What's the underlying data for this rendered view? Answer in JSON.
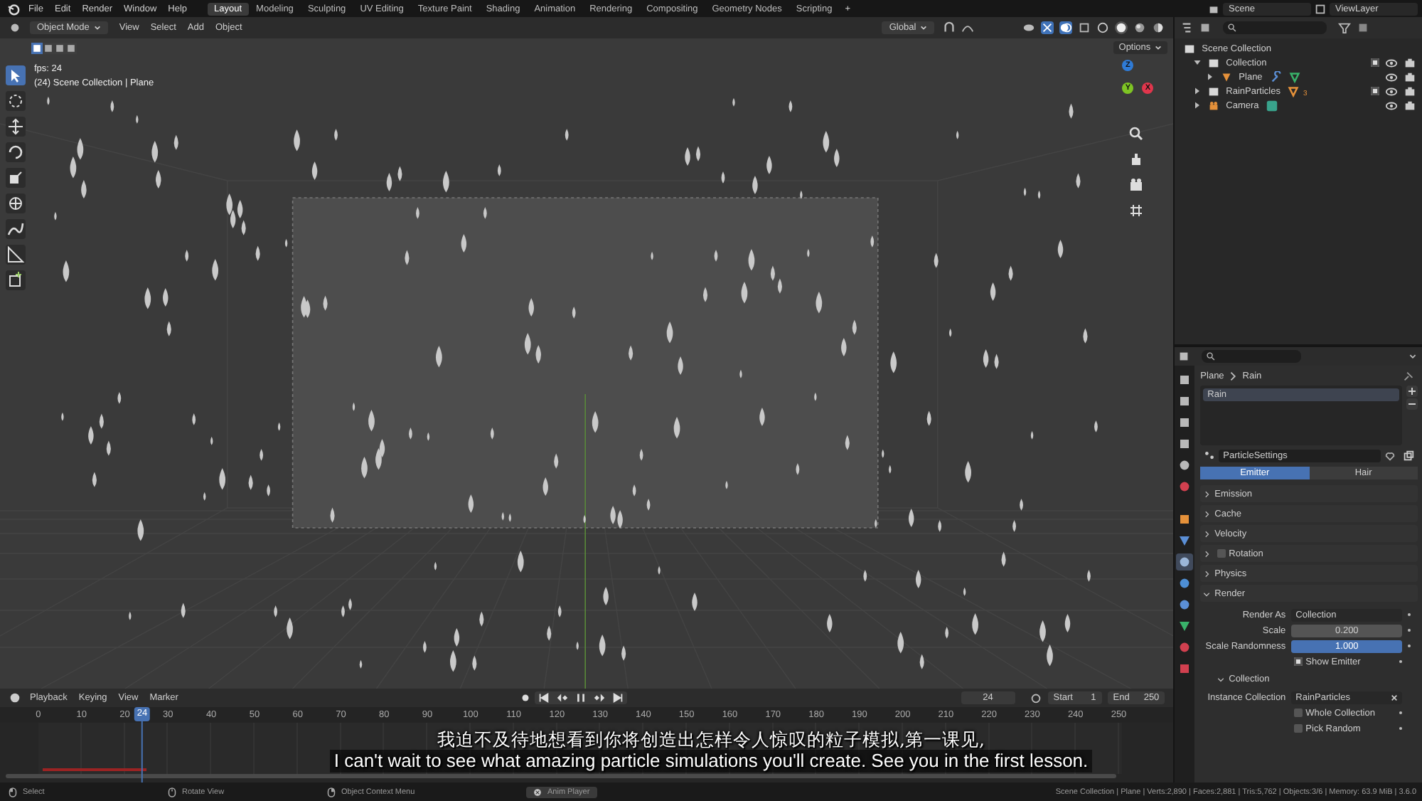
{
  "top_bar": {
    "menus": [
      "File",
      "Edit",
      "Render",
      "Window",
      "Help"
    ],
    "workspaces": [
      {
        "label": "Layout",
        "selected": true
      },
      {
        "label": "Modeling",
        "selected": false
      },
      {
        "label": "Sculpting",
        "selected": false
      },
      {
        "label": "UV Editing",
        "selected": false
      },
      {
        "label": "Texture Paint",
        "selected": false
      },
      {
        "label": "Shading",
        "selected": false
      },
      {
        "label": "Animation",
        "selected": false
      },
      {
        "label": "Rendering",
        "selected": false
      },
      {
        "label": "Compositing",
        "selected": false
      },
      {
        "label": "Geometry Nodes",
        "selected": false
      },
      {
        "label": "Scripting",
        "selected": false
      }
    ],
    "add_workspace": "+",
    "scene": "Scene",
    "view_layer": "ViewLayer"
  },
  "viewport": {
    "mode": "Object Mode",
    "menus": [
      "View",
      "Select",
      "Add",
      "Object"
    ],
    "orientation": "Global",
    "shading": [
      {
        "kind": "wireframe",
        "selected": false
      },
      {
        "kind": "solid",
        "selected": true
      },
      {
        "kind": "material",
        "selected": false
      },
      {
        "kind": "rendered",
        "selected": false
      }
    ],
    "overlay_text": [
      "fps: 24",
      "(24) Scene Collection | Plane"
    ],
    "options": "Options",
    "tools": [
      {
        "kind": "select",
        "selected": true
      },
      {
        "kind": "cursor",
        "selected": false
      },
      {
        "kind": "move",
        "selected": false
      },
      {
        "kind": "rotate",
        "selected": false
      },
      {
        "kind": "scale",
        "selected": false
      },
      {
        "kind": "transform",
        "selected": false
      },
      {
        "kind": "annotate",
        "selected": false
      },
      {
        "kind": "measure",
        "selected": false
      },
      {
        "kind": "add_cube",
        "selected": false
      }
    ],
    "gizmo_axes": [
      {
        "label": "Z",
        "color": "#2f7bd6"
      },
      {
        "label": "Y",
        "color": "#7ec424"
      },
      {
        "label": "X",
        "color": "#e0364c"
      }
    ]
  },
  "outliner": {
    "tree": [
      {
        "label": "Scene Collection",
        "kind": "scene",
        "children": [
          {
            "label": "Collection",
            "kind": "collection",
            "expanded": true,
            "checked": true,
            "children": [
              {
                "label": "Plane",
                "kind": "mesh",
                "expanded": false,
                "modifier": true,
                "mesh_data": true
              }
            ]
          },
          {
            "label": "RainParticles",
            "kind": "collection",
            "expanded": false,
            "checked": true,
            "mesh_data": true,
            "count": "3"
          },
          {
            "label": "Camera",
            "kind": "camera",
            "expanded": false,
            "camera_data": true
          }
        ]
      }
    ]
  },
  "properties": {
    "tabs": [
      {
        "kind": "tool",
        "selected": false
      },
      {
        "kind": "render",
        "selected": false
      },
      {
        "kind": "output",
        "selected": false
      },
      {
        "kind": "view_layer",
        "selected": false
      },
      {
        "kind": "scene",
        "selected": false
      },
      {
        "kind": "world",
        "selected": false
      },
      {
        "kind": "object",
        "selected": false
      },
      {
        "kind": "modifiers",
        "selected": false
      },
      {
        "kind": "particles",
        "selected": true
      },
      {
        "kind": "physics",
        "selected": false
      },
      {
        "kind": "constraints",
        "selected": false
      },
      {
        "kind": "data",
        "selected": false
      },
      {
        "kind": "material",
        "selected": false
      },
      {
        "kind": "texture",
        "selected": false
      }
    ],
    "breadcrumb": [
      "Plane",
      "Rain"
    ],
    "particle_systems": [
      {
        "label": "Rain",
        "selected": true
      }
    ],
    "settings_name": "ParticleSettings",
    "type_tabs": [
      {
        "label": "Emitter",
        "selected": true
      },
      {
        "label": "Hair",
        "selected": false
      }
    ],
    "panels": [
      {
        "label": "Emission",
        "expanded": false
      },
      {
        "label": "Cache",
        "expanded": false
      },
      {
        "label": "Velocity",
        "expanded": false
      },
      {
        "label": "Rotation",
        "expanded": false,
        "checked": false
      },
      {
        "label": "Physics",
        "expanded": false
      },
      {
        "label": "Render",
        "expanded": true
      }
    ],
    "render_rows": [
      {
        "kind": "dropdown",
        "label": "Render As",
        "value": "Collection"
      },
      {
        "kind": "number",
        "label": "Scale",
        "value": "0.200"
      },
      {
        "kind": "slider",
        "label": "Scale Randomness",
        "value": "1.000",
        "level": 1
      },
      {
        "kind": "checkbox",
        "label": "Show Emitter",
        "checked": true
      }
    ],
    "subpanel": {
      "label": "Collection",
      "expanded": true,
      "rows": [
        {
          "kind": "field",
          "label": "Instance Collection",
          "value": "RainParticles"
        },
        {
          "kind": "checkbox",
          "label": "Whole Collection",
          "checked": false
        },
        {
          "kind": "checkbox",
          "label": "Pick Random",
          "checked": false
        }
      ]
    }
  },
  "timeline": {
    "menus": [
      "Playback",
      "Keying",
      "View",
      "Marker"
    ],
    "ticks": [
      "0",
      "10",
      "20",
      "30",
      "40",
      "50",
      "60",
      "70",
      "80",
      "90",
      "100",
      "110",
      "120",
      "130",
      "140",
      "150",
      "160",
      "170",
      "180",
      "190",
      "200",
      "210",
      "220",
      "230",
      "240",
      "250"
    ],
    "playhead": {
      "label": "24",
      "level": 0.096
    },
    "current_frame": "24",
    "start_label": "Start",
    "start": "1",
    "end_label": "End",
    "end": "250"
  },
  "subtitles": [
    "我迫不及待地想看到你将创造出怎样令人惊叹的粒子模拟,第一课见,",
    "I can't wait to see what amazing particle simulations you'll create. See you in the first lesson."
  ],
  "status_bar": {
    "hints": [
      {
        "kind": "mouse_left",
        "label": "Select"
      },
      {
        "kind": "mouse_middle",
        "label": "Rotate View"
      },
      {
        "kind": "mouse_right",
        "label": "Object Context Menu"
      }
    ],
    "anim_player": "Anim Player",
    "stats": "Scene Collection | Plane | Verts:2,890 | Faces:2,881 | Tris:5,762 | Objects:3/6 | Memory: 63.9 MiB | 3.6.0"
  }
}
